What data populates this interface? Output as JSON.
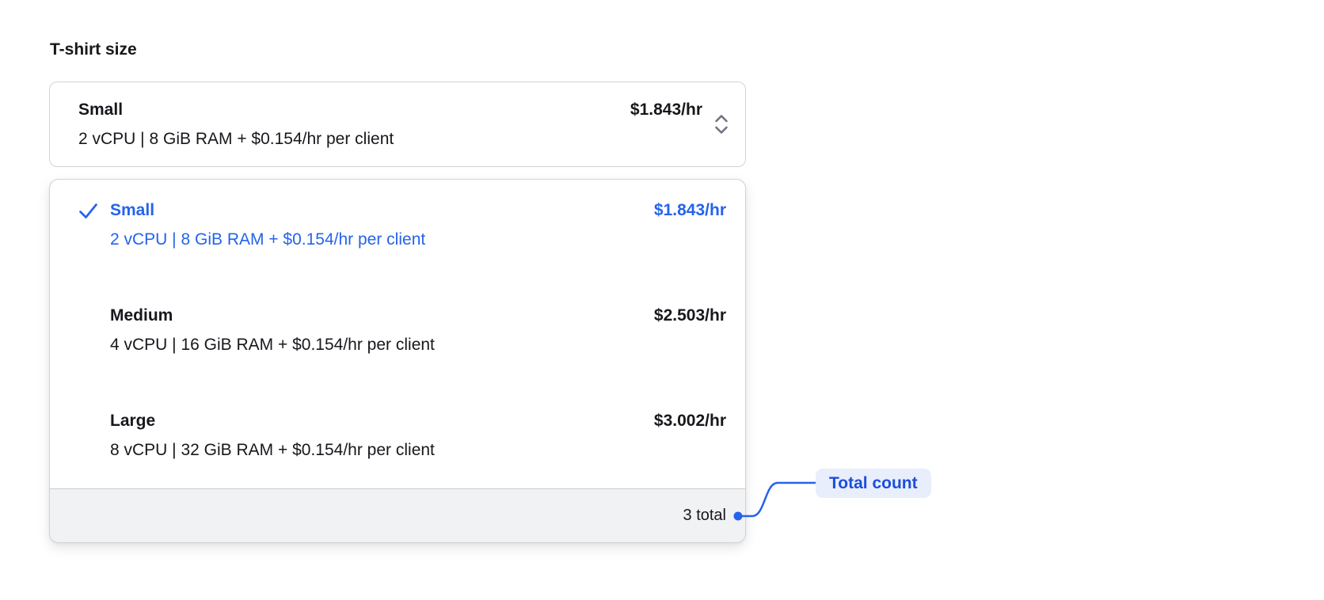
{
  "colors": {
    "accent": "#2563eb",
    "annotation_text": "#1d4ed8",
    "annotation_bg": "#e8eefb",
    "text": "#17181c",
    "muted_icon": "#6e7480",
    "border": "#d0d3d9",
    "footer_bg": "#f1f2f4",
    "footer_border": "#c9ccd2",
    "background": "#ffffff"
  },
  "field": {
    "label": "T-shirt size"
  },
  "select": {
    "selected_option": {
      "name": "Small",
      "description": "2 vCPU | 8 GiB RAM + $0.154/hr per client",
      "price": "$1.843/hr"
    },
    "chevron_icon": "chevron-up-down"
  },
  "dropdown": {
    "options": [
      {
        "name": "Small",
        "description": "2 vCPU | 8 GiB RAM + $0.154/hr per client",
        "price": "$1.843/hr",
        "selected": true
      },
      {
        "name": "Medium",
        "description": "4 vCPU | 16 GiB RAM + $0.154/hr per client",
        "price": "$2.503/hr",
        "selected": false
      },
      {
        "name": "Large",
        "description": "8 vCPU | 32 GiB RAM + $0.154/hr per client",
        "price": "$3.002/hr",
        "selected": false
      }
    ],
    "footer": {
      "total": "3 total"
    }
  },
  "annotation": {
    "label": "Total count",
    "dot_icon": "connector-dot"
  }
}
